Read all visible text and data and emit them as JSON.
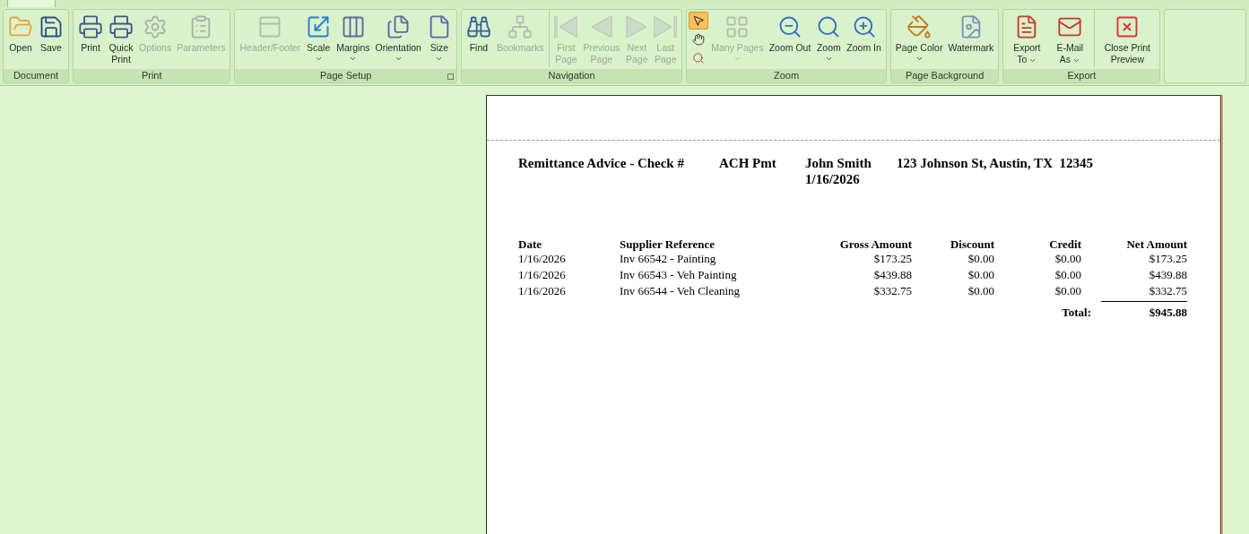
{
  "ribbon": {
    "groups": [
      {
        "label": "Document",
        "launcher": false,
        "buttons": [
          {
            "kind": "folder",
            "label": "Open",
            "disabled": false,
            "dropdown": false,
            "separator_before": false
          },
          {
            "kind": "save",
            "label": "Save",
            "disabled": false,
            "dropdown": false,
            "separator_before": false
          }
        ]
      },
      {
        "label": "Print",
        "launcher": false,
        "buttons": [
          {
            "kind": "printer",
            "label": "Print",
            "disabled": false,
            "dropdown": false,
            "separator_before": false
          },
          {
            "kind": "quickprint",
            "label": "Quick Print",
            "disabled": false,
            "dropdown": false,
            "separator_before": false
          },
          {
            "kind": "options",
            "label": "Options",
            "disabled": true,
            "dropdown": false,
            "separator_before": false
          },
          {
            "kind": "clipboard",
            "label": "Parameters",
            "disabled": true,
            "dropdown": false,
            "separator_before": false
          }
        ]
      },
      {
        "label": "Page Setup",
        "launcher": true,
        "buttons": [
          {
            "kind": "header",
            "label": "Header/Footer",
            "disabled": true,
            "dropdown": false,
            "separator_before": false
          },
          {
            "kind": "scale",
            "label": "Scale",
            "disabled": false,
            "dropdown": true,
            "separator_before": false
          },
          {
            "kind": "margins",
            "label": "Margins",
            "disabled": false,
            "dropdown": true,
            "separator_before": false
          },
          {
            "kind": "orientation",
            "label": "Orientation",
            "disabled": false,
            "dropdown": true,
            "separator_before": false
          },
          {
            "kind": "size",
            "label": "Size",
            "disabled": false,
            "dropdown": true,
            "separator_before": false
          }
        ]
      },
      {
        "label": "Navigation",
        "launcher": false,
        "buttons": [
          {
            "kind": "binoculars",
            "label": "Find",
            "disabled": false,
            "dropdown": false,
            "separator_before": false
          },
          {
            "kind": "tree",
            "label": "Bookmarks",
            "disabled": true,
            "dropdown": false,
            "separator_before": false
          },
          {
            "kind": "first",
            "label": "First Page",
            "disabled": true,
            "dropdown": false,
            "separator_before": true
          },
          {
            "kind": "prev",
            "label": "Previous Page",
            "disabled": true,
            "dropdown": false,
            "separator_before": false
          },
          {
            "kind": "next",
            "label": "Next Page",
            "disabled": true,
            "dropdown": false,
            "separator_before": false
          },
          {
            "kind": "last",
            "label": "Last Page",
            "disabled": true,
            "dropdown": false,
            "separator_before": false
          }
        ]
      },
      {
        "label": "Zoom",
        "launcher": false,
        "tools": [
          {
            "kind": "pointer",
            "selected": true
          },
          {
            "kind": "hand",
            "selected": false
          },
          {
            "kind": "magnifier",
            "selected": false
          }
        ],
        "buttons": [
          {
            "kind": "pages",
            "label": "Many Pages",
            "disabled": true,
            "dropdown": true,
            "separator_before": false
          },
          {
            "kind": "zoomout",
            "label": "Zoom Out",
            "disabled": false,
            "dropdown": false,
            "separator_before": false
          },
          {
            "kind": "zoom",
            "label": "Zoom",
            "disabled": false,
            "dropdown": true,
            "separator_before": false
          },
          {
            "kind": "zoomin",
            "label": "Zoom In",
            "disabled": false,
            "dropdown": false,
            "separator_before": false
          }
        ]
      },
      {
        "label": "Page Background",
        "launcher": false,
        "buttons": [
          {
            "kind": "paint",
            "label": "Page Color",
            "disabled": false,
            "dropdown": true,
            "separator_before": false
          },
          {
            "kind": "watermark",
            "label": "Watermark",
            "disabled": false,
            "dropdown": false,
            "separator_before": false
          }
        ]
      },
      {
        "label": "Export",
        "launcher": false,
        "buttons": [
          {
            "kind": "pdf",
            "label": "Export To",
            "disabled": false,
            "dropdown": true,
            "separator_before": false
          },
          {
            "kind": "pdfmail",
            "label": "E-Mail As",
            "disabled": false,
            "dropdown": true,
            "separator_before": false
          },
          {
            "kind": "close",
            "label": "Close Print Preview",
            "disabled": false,
            "dropdown": false,
            "separator_before": true
          }
        ]
      }
    ]
  },
  "report": {
    "title": "Remittance Advice - Check #",
    "check_number": "ACH Pmt",
    "payee": "John Smith",
    "date": "1/16/2026",
    "address": "123 Johnson St, Austin, TX  12345",
    "columns": [
      "Date",
      "Supplier Reference",
      "Gross Amount",
      "Discount",
      "Credit",
      "Net Amount"
    ],
    "rows": [
      [
        "1/16/2026",
        "Inv 66542 - Painting",
        "$173.25",
        "$0.00",
        "$0.00",
        "$173.25"
      ],
      [
        "1/16/2026",
        "Inv 66543 - Veh Painting",
        "$439.88",
        "$0.00",
        "$0.00",
        "$439.88"
      ],
      [
        "1/16/2026",
        "Inv 66544 - Veh Cleaning",
        "$332.75",
        "$0.00",
        "$0.00",
        "$332.75"
      ]
    ],
    "total_label": "Total:",
    "total": "$945.88"
  }
}
